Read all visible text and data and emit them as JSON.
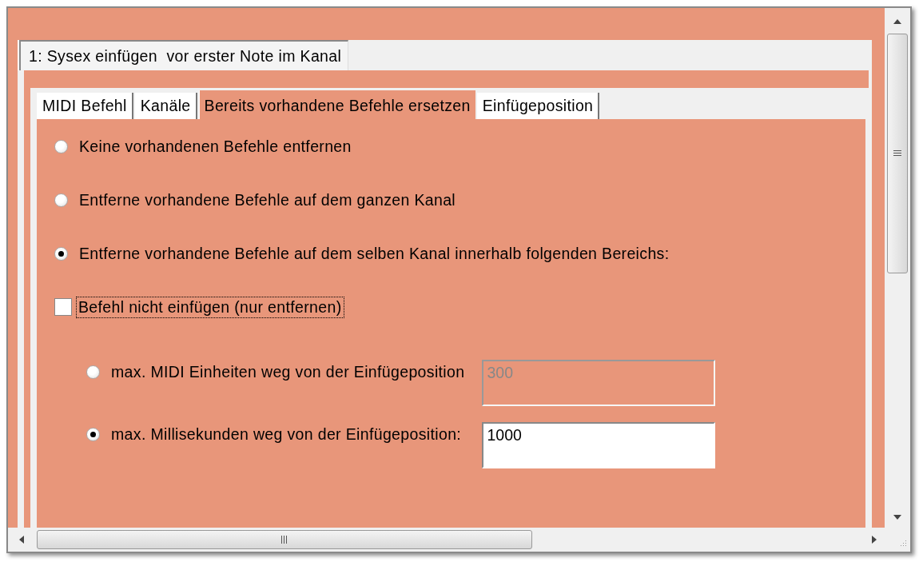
{
  "outer_tabs": [
    {
      "label": "1: Sysex einfügen  vor erster Note im Kanal",
      "selected": true
    }
  ],
  "inner_tabs": [
    {
      "label": "MIDI Befehl",
      "selected": false
    },
    {
      "label": "Kanäle",
      "selected": false
    },
    {
      "label": "Bereits vorhandene Befehle ersetzen",
      "selected": true
    },
    {
      "label": "Einfügeposition",
      "selected": false
    }
  ],
  "replace_options": [
    {
      "label": "Keine vorhandenen Befehle entfernen",
      "selected": false
    },
    {
      "label": "Entferne vorhandene Befehle auf dem ganzen Kanal",
      "selected": false
    },
    {
      "label": "Entferne vorhandene Befehle auf dem selben Kanal innerhalb folgenden Bereichs:",
      "selected": true
    }
  ],
  "remove_only": {
    "label": "Befehl nicht einfügen (nur entfernen)",
    "checked": false,
    "focused": true
  },
  "range_options": [
    {
      "label": "max. MIDI Einheiten weg von der Einfügeposition",
      "selected": false,
      "value": "300",
      "disabled": true
    },
    {
      "label": "max. Millisekunden weg von der Einfügeposition:",
      "selected": true,
      "value": "1000",
      "disabled": false
    }
  ]
}
